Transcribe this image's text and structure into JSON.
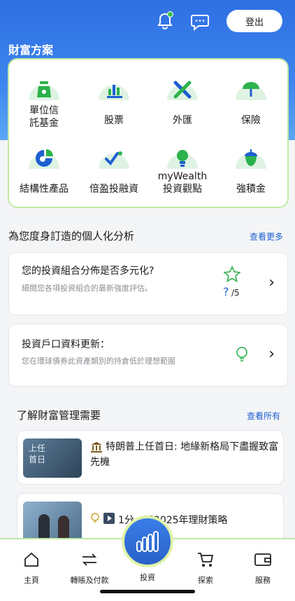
{
  "header": {
    "logout_label": "登出"
  },
  "wealth_section_title": "財富方案",
  "products": [
    {
      "label": "單位信\n託基金",
      "icon": "fund-bag-icon"
    },
    {
      "label": "股票",
      "icon": "stock-chart-icon"
    },
    {
      "label": "外匯",
      "icon": "fx-cross-icon"
    },
    {
      "label": "保險",
      "icon": "umbrella-icon"
    },
    {
      "label": "結構性產品",
      "icon": "pie-structure-icon"
    },
    {
      "label": "倍盈投融資",
      "icon": "leverage-check-icon"
    },
    {
      "label": "myWealth\n投資觀點",
      "icon": "bulb-insight-icon"
    },
    {
      "label": "強積金",
      "icon": "acorn-icon"
    }
  ],
  "analysis": {
    "heading": "為您度身訂造的個人化分析",
    "more_label": "查看更多",
    "card1": {
      "title": "您的投資組合分佈是否多元化?",
      "subtitle": "細閱您各項投資組合的最新強度評估。",
      "score_value": "?",
      "score_total": "/5"
    },
    "card2": {
      "title": "投資戶口資料更新：",
      "subtitle": "您在環球債券此資產類別的持倉低於理想範圍"
    }
  },
  "learn": {
    "heading": "了解財富管理需要",
    "more_label": "查看所有",
    "news": [
      {
        "title": "特朗普上任首日: 地緣新格局下盡握致富先機",
        "thumb_text": "上任\n首日"
      },
      {
        "title": "1分…了2025年理財策略"
      }
    ]
  },
  "tabs": [
    {
      "label": "主頁"
    },
    {
      "label": "轉賬及付款"
    },
    {
      "label": "投資"
    },
    {
      "label": "探索"
    },
    {
      "label": "服務"
    }
  ],
  "colors": {
    "brand_blue": "#2f6fe3",
    "accent_green": "#2bb24c",
    "border_green": "#bfe9a3"
  }
}
